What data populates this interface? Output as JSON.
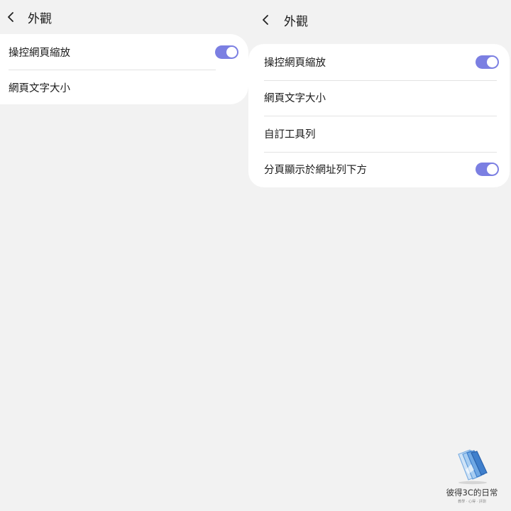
{
  "left_pane": {
    "title": "外觀",
    "back_icon": "chevron-left-icon",
    "settings": [
      {
        "label": "操控網頁縮放",
        "toggle": true
      },
      {
        "label": "網頁文字大小"
      }
    ]
  },
  "right_pane": {
    "title": "外觀",
    "back_icon": "chevron-left-icon",
    "settings": [
      {
        "label": "操控網頁縮放",
        "toggle": true
      },
      {
        "label": "網頁文字大小"
      },
      {
        "label": "自訂工具列"
      },
      {
        "label": "分頁顯示於網址列下方",
        "toggle": true
      }
    ]
  },
  "colors": {
    "background": "#f2f2f2",
    "card": "#ffffff",
    "toggle_on": "#7b7fe2",
    "divider": "#e3e3e3"
  },
  "watermark": {
    "text": "彼得3C的日常",
    "subtext": "教學 · 心得 · 評測"
  }
}
